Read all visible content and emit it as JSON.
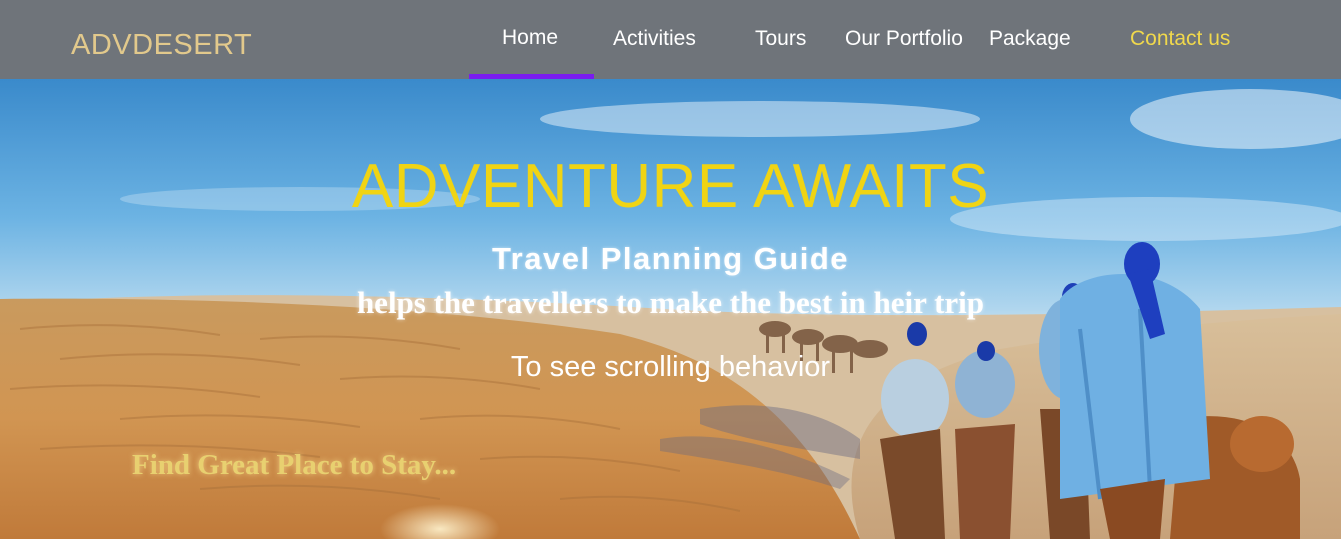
{
  "navbar": {
    "brand": "ADVDESERT",
    "items": [
      {
        "label": "Home",
        "active": true
      },
      {
        "label": "Activities"
      },
      {
        "label": "Tours"
      },
      {
        "label": "Our Portfolio"
      },
      {
        "label": "Package"
      },
      {
        "label": "Contact us"
      }
    ],
    "active_underline_color": "#7a1cf0",
    "background": "#6f747a",
    "brand_color": "#e2c98c",
    "contact_color": "#f0d84c"
  },
  "hero": {
    "title": "ADVENTURE AWAITS",
    "subtitle": "Travel Planning Guide",
    "tagline": "helps the travellers to make the best in heir trip",
    "scroll_note": "To see scrolling behavior",
    "find_text": "Find Great Place to Stay...",
    "title_color": "#f0d414"
  }
}
